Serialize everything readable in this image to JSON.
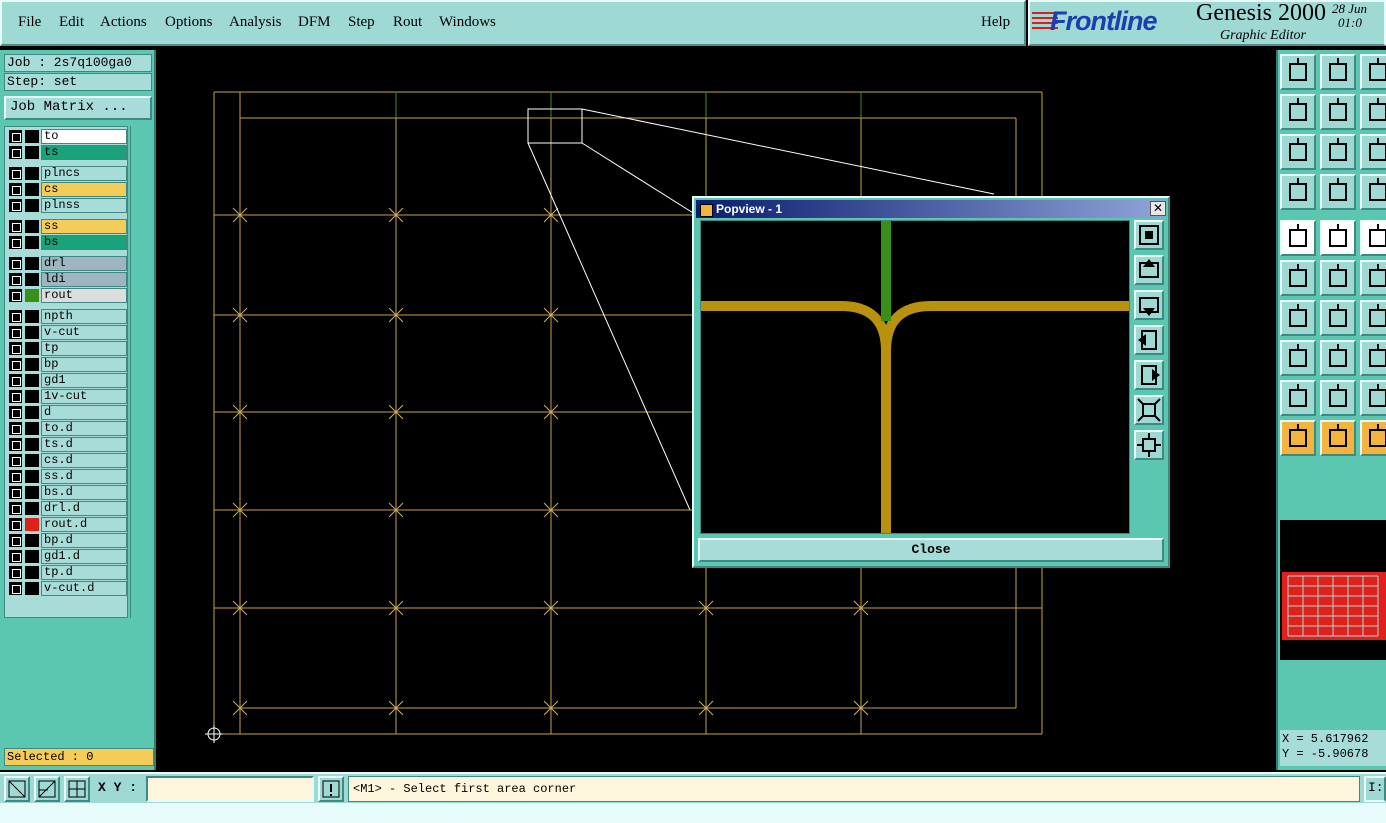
{
  "menu": {
    "items": [
      {
        "label": "File"
      },
      {
        "label": "Edit"
      },
      {
        "label": "Actions"
      },
      {
        "label": "Options"
      },
      {
        "label": "Analysis"
      },
      {
        "label": "DFM"
      },
      {
        "label": "Step"
      },
      {
        "label": "Rout"
      },
      {
        "label": "Windows"
      }
    ],
    "help": "Help"
  },
  "brand": {
    "logo": "Frontline",
    "product": "Genesis 2000",
    "subtitle": "Graphic Editor",
    "date_line1": "28 Jun",
    "date_line2": "01:0"
  },
  "left": {
    "job": "Job : 2s7q100ga0",
    "step": "Step: set",
    "job_matrix": "Job Matrix ...",
    "selected": "Selected : 0",
    "layers": [
      {
        "name": "to",
        "color": "#ffffff",
        "swatch": "#000000"
      },
      {
        "name": "ts",
        "color": "#1aa37a",
        "swatch": "#000000"
      },
      {
        "name": "plncs",
        "color": "#a8dcd8",
        "swatch": "#000000"
      },
      {
        "name": "cs",
        "color": "#f5cc57",
        "swatch": "#000000"
      },
      {
        "name": "plnss",
        "color": "#a8dcd8",
        "swatch": "#000000"
      },
      {
        "name": "ss",
        "color": "#f5cc57",
        "swatch": "#000000"
      },
      {
        "name": "bs",
        "color": "#1aa37a",
        "swatch": "#000000"
      },
      {
        "name": "drl",
        "color": "#9eb4be",
        "swatch": "#000000"
      },
      {
        "name": "ldi",
        "color": "#9eb4be",
        "swatch": "#000000"
      },
      {
        "name": "rout",
        "color": "#dddddd",
        "swatch": "#3a8f1a"
      },
      {
        "name": "npth",
        "color": "#a8dcd8",
        "swatch": "#000000"
      },
      {
        "name": "v-cut",
        "color": "#a8dcd8",
        "swatch": "#000000"
      },
      {
        "name": "tp",
        "color": "#a8dcd8",
        "swatch": "#000000"
      },
      {
        "name": "bp",
        "color": "#a8dcd8",
        "swatch": "#000000"
      },
      {
        "name": "gd1",
        "color": "#a8dcd8",
        "swatch": "#000000"
      },
      {
        "name": "1v-cut",
        "color": "#a8dcd8",
        "swatch": "#000000"
      },
      {
        "name": "d",
        "color": "#a8dcd8",
        "swatch": "#000000"
      },
      {
        "name": "to.d",
        "color": "#a8dcd8",
        "swatch": "#000000"
      },
      {
        "name": "ts.d",
        "color": "#a8dcd8",
        "swatch": "#000000"
      },
      {
        "name": "cs.d",
        "color": "#a8dcd8",
        "swatch": "#000000"
      },
      {
        "name": "ss.d",
        "color": "#a8dcd8",
        "swatch": "#000000"
      },
      {
        "name": "bs.d",
        "color": "#a8dcd8",
        "swatch": "#000000"
      },
      {
        "name": "drl.d",
        "color": "#a8dcd8",
        "swatch": "#000000"
      },
      {
        "name": "rout.d",
        "color": "#a8dcd8",
        "swatch": "#e0201a"
      },
      {
        "name": "bp.d",
        "color": "#a8dcd8",
        "swatch": "#000000"
      },
      {
        "name": "gd1.d",
        "color": "#a8dcd8",
        "swatch": "#000000"
      },
      {
        "name": "tp.d",
        "color": "#a8dcd8",
        "swatch": "#000000"
      },
      {
        "name": "v-cut.d",
        "color": "#a8dcd8",
        "swatch": "#000000"
      }
    ]
  },
  "popview": {
    "title": "Popview - 1",
    "close_x": "✕",
    "close_label": "Close"
  },
  "coords": {
    "x": "X = 5.617962",
    "y": "Y = -5.90678"
  },
  "bottom": {
    "xy_label": "X Y :",
    "xy_value": "",
    "prompt": "<M1> - Select first area corner",
    "right_btn": "I:"
  },
  "colors": {
    "panel": "#5bc7b0",
    "menu": "#9fd9d4",
    "canvas": "#000000",
    "outline": "#c9a04a",
    "green": "#3a8f1a",
    "gold": "#b8910e"
  }
}
